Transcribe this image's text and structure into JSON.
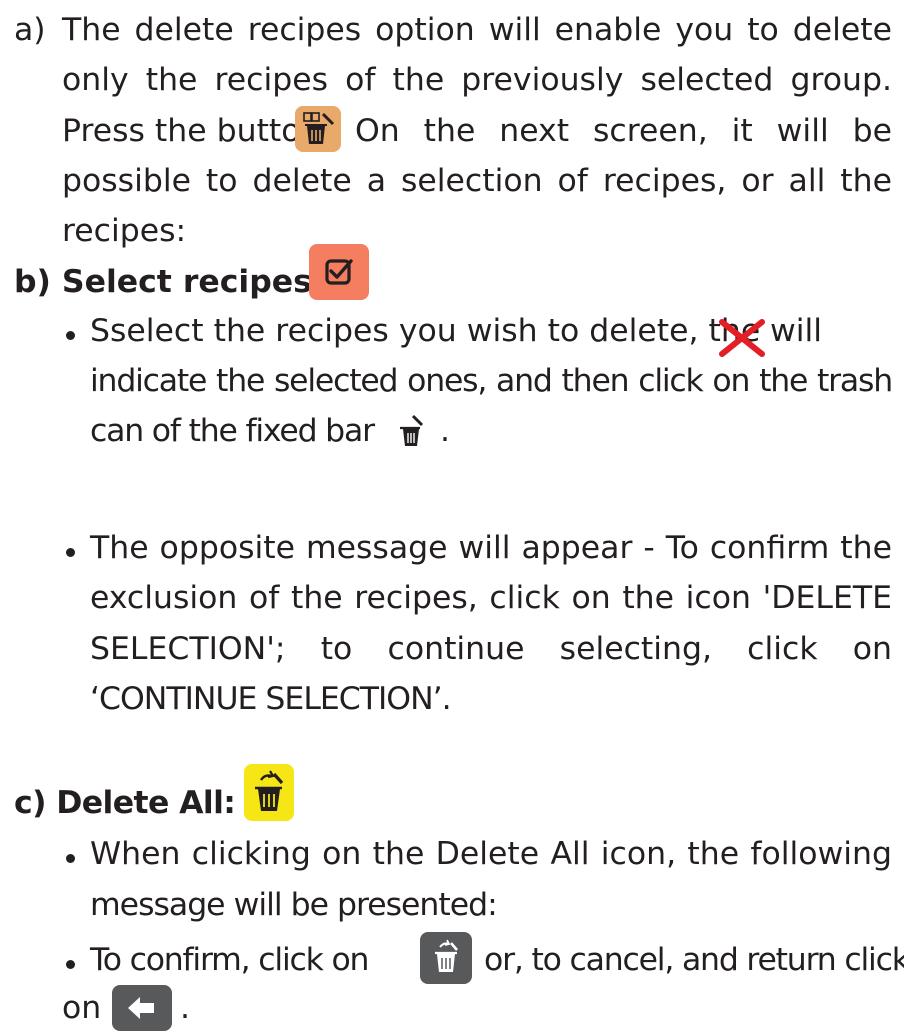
{
  "section_a": {
    "marker": "a)",
    "line1": "The delete recipes option will enable you to delete",
    "line2": "only the recipes of the previously selected group.",
    "line3_before": "Press the button.",
    "line3_after": "On the next screen, it will be",
    "line4": "possible to delete a selection of recipes, or all the",
    "line5": "recipes:",
    "icon": "delete-recipes-icon",
    "icon_color": "#e8a96a"
  },
  "section_b": {
    "heading": "b) Select recipes:",
    "icon": "checkbox-icon",
    "icon_color": "#f47e5f",
    "bullet1_line1_before": "Sselect the recipes you wish to delete, the",
    "bullet1_line1_after": "will",
    "bullet1_line2": "indicate the selected ones, and then click on the trash",
    "bullet1_line3_before": "can of the fixed bar",
    "bullet1_line3_after": ".",
    "x_icon": "red-x-icon",
    "x_color": "#e31e24",
    "bullet2_line1": "The opposite message will appear - To confirm the",
    "bullet2_line2": "exclusion of the recipes, click on the icon 'DELETE",
    "bullet2_line3": "SELECTION'; to continue selecting, click on",
    "bullet2_line4": "‘CONTINUE SELECTION’."
  },
  "section_c": {
    "heading": "c) Delete All:",
    "icon": "delete-all-icon",
    "icon_color": "#f7e616",
    "bullet1_line1": "When clicking on the Delete All icon, the following",
    "bullet1_line2": "message will be presented:",
    "bullet2_line1_before": "To confirm, click on",
    "bullet2_line1_after": "or, to cancel, and return click",
    "bullet2_line2_before": "on",
    "bullet2_line2_after": ".",
    "confirm_icon": "trash-confirm-icon",
    "back_icon": "back-arrow-icon",
    "button_color": "#58595b"
  }
}
